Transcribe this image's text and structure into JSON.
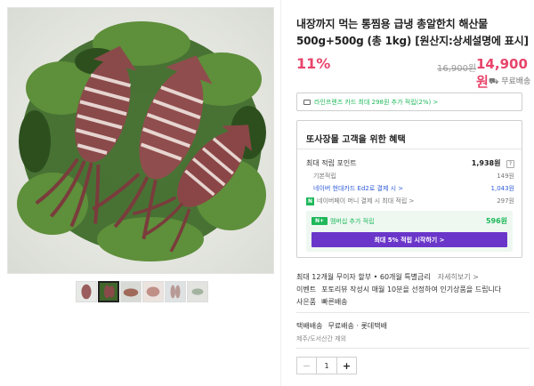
{
  "product": {
    "title": "내장까지 먹는 통찜용 급냉 총알한치 해산물 500g+500g (총 1kg) [원산지:상세설명에 표시]",
    "discount": "11%",
    "original_price": "16,900원",
    "sale_price": "14,900원",
    "shipping_badge": "무료배송"
  },
  "card_promo": "라인프렌즈 카드 최대 298원 추가 적립(2%) >",
  "benefits": {
    "title": "또사장몰 고객을 위한 혜택",
    "max_points_label": "최대 적립 포인트",
    "max_points_value": "1,938원",
    "help_mark": "?",
    "basic_label": "기본적립",
    "basic_value": "149원",
    "card_label": "네이버 현대카드 Ed2로 결제 시 >",
    "card_value": "1,043원",
    "pay_label": "네이버페이 머니 결제 시 최대 적립 >",
    "pay_value": "297원",
    "pay_mark": "N",
    "member_badge": "N+",
    "member_label": "멤버십 추가 적립",
    "member_value": "596원",
    "member_cta": "최대 5% 적립 시작하기 >"
  },
  "meta": {
    "installment": "최대 12개월 무이자 할부 • 60개월 특별금리",
    "installment_link": "자세히보기 >",
    "event_key": "이벤트",
    "event_value": "포토리뷰 작성시 매월 10분을 선정하여 인기상품을 드립니다",
    "gift_key": "사은품",
    "gift_value": "빠른배송",
    "ship_key": "택배배송",
    "ship_value": "무료배송 · 롯데택배",
    "ship_sub": "제주/도서산간 제외"
  },
  "quantity": {
    "minus": "−",
    "value": "1",
    "plus": "+"
  },
  "colors": {
    "accent_pink": "#e8456b",
    "naver_green": "#1eb85a",
    "membership_purple": "#6a36c9",
    "link_blue": "#2e5bd8"
  }
}
